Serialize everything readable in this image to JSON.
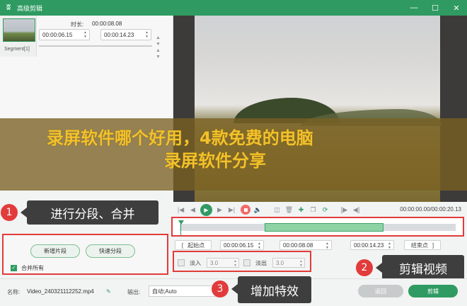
{
  "window": {
    "title": "高级剪辑",
    "logo": "ʬ"
  },
  "segments": {
    "label": "Segment[1]"
  },
  "duration": {
    "label": "时长:",
    "value": "00:00:08.08"
  },
  "time_fields": {
    "start": "00:00:06.15",
    "end": "00:00:14.23"
  },
  "controls": {
    "timecode": "00:00:00.00/00:00:20.13"
  },
  "trim": {
    "start_button": "起始点",
    "start_value": "00:00:06.15",
    "duration_value": "00:00:08.08",
    "end_value": "00:00:14.23",
    "end_button": "结束点"
  },
  "fade": {
    "in_label": "淡入",
    "in_value": "3.0",
    "out_label": "淡出",
    "out_value": "3.0"
  },
  "segment_actions": {
    "new_segment": "新增片段",
    "quick_split": "快速分段",
    "merge_all": "合并所有"
  },
  "banner": {
    "line1": "录屏软件哪个好用，4款免费的电脑",
    "line2": "录屏软件分享"
  },
  "callouts": {
    "c1": {
      "num": "1",
      "text": "进行分段、合并"
    },
    "c2": {
      "num": "2",
      "text": "剪辑视频"
    },
    "c3": {
      "num": "3",
      "text": "增加特效"
    }
  },
  "bottom": {
    "name_label": "名称:",
    "name_value": "Video_240321112252.mp4",
    "output_label": "输出:",
    "output_value": "自动;Auto",
    "reset_button": "返回",
    "cut_button": "剪辑"
  },
  "colors": {
    "accent": "#2f9b62",
    "highlight": "#e23b3b",
    "banner_text": "#f3c22a"
  }
}
